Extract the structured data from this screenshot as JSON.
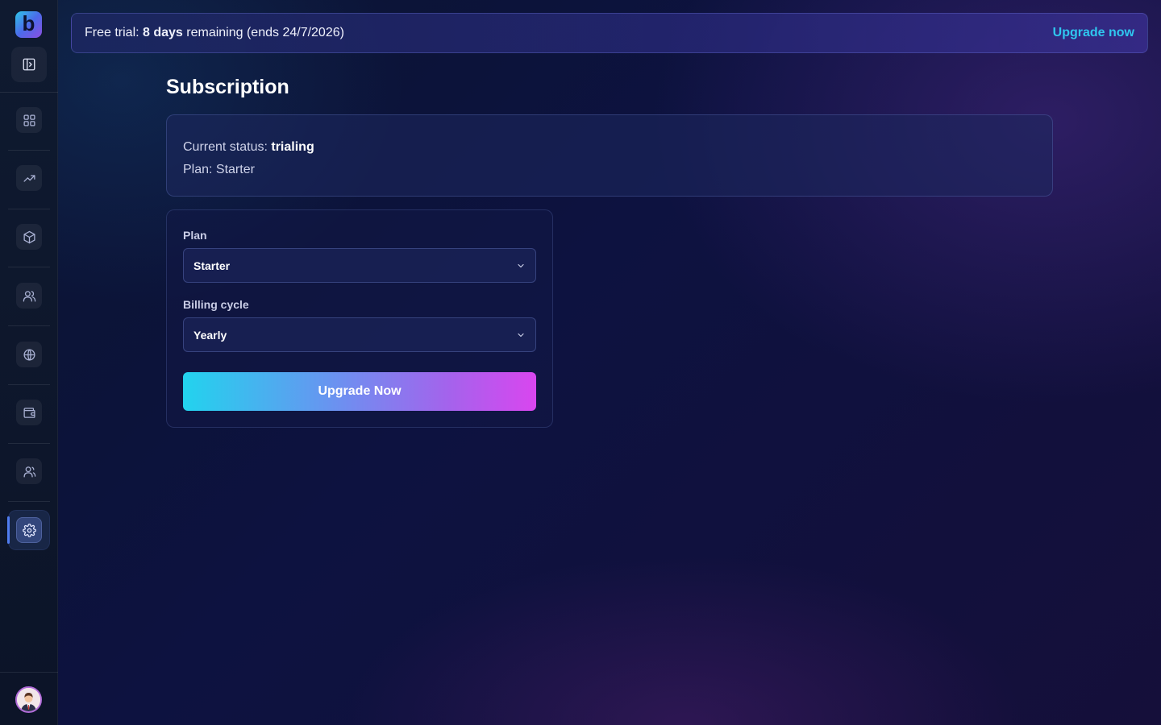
{
  "sidebar": {
    "logo_letter": "b",
    "items": [
      {
        "name": "dashboard",
        "icon": "grid-icon"
      },
      {
        "name": "analytics",
        "icon": "trending-up-icon"
      },
      {
        "name": "products",
        "icon": "box-icon"
      },
      {
        "name": "customers",
        "icon": "users-icon"
      },
      {
        "name": "web",
        "icon": "globe-icon"
      },
      {
        "name": "wallet",
        "icon": "wallet-icon"
      },
      {
        "name": "team",
        "icon": "team-icon"
      },
      {
        "name": "settings",
        "icon": "gear-icon",
        "active": true
      }
    ],
    "accent": "#4f7cf0"
  },
  "banner": {
    "prefix": "Free trial: ",
    "days": "8 days",
    "suffix": " remaining (ends 24/7/2026)",
    "link": "Upgrade now",
    "link_color": "#2fc7ef"
  },
  "page": {
    "title": "Subscription"
  },
  "status": {
    "status_label": "Current status: ",
    "status_value": "trialing",
    "plan_line": "Plan: Starter"
  },
  "form": {
    "plan_label": "Plan",
    "plan_value": "Starter",
    "cycle_label": "Billing cycle",
    "cycle_value": "Yearly",
    "button": "Upgrade Now"
  }
}
